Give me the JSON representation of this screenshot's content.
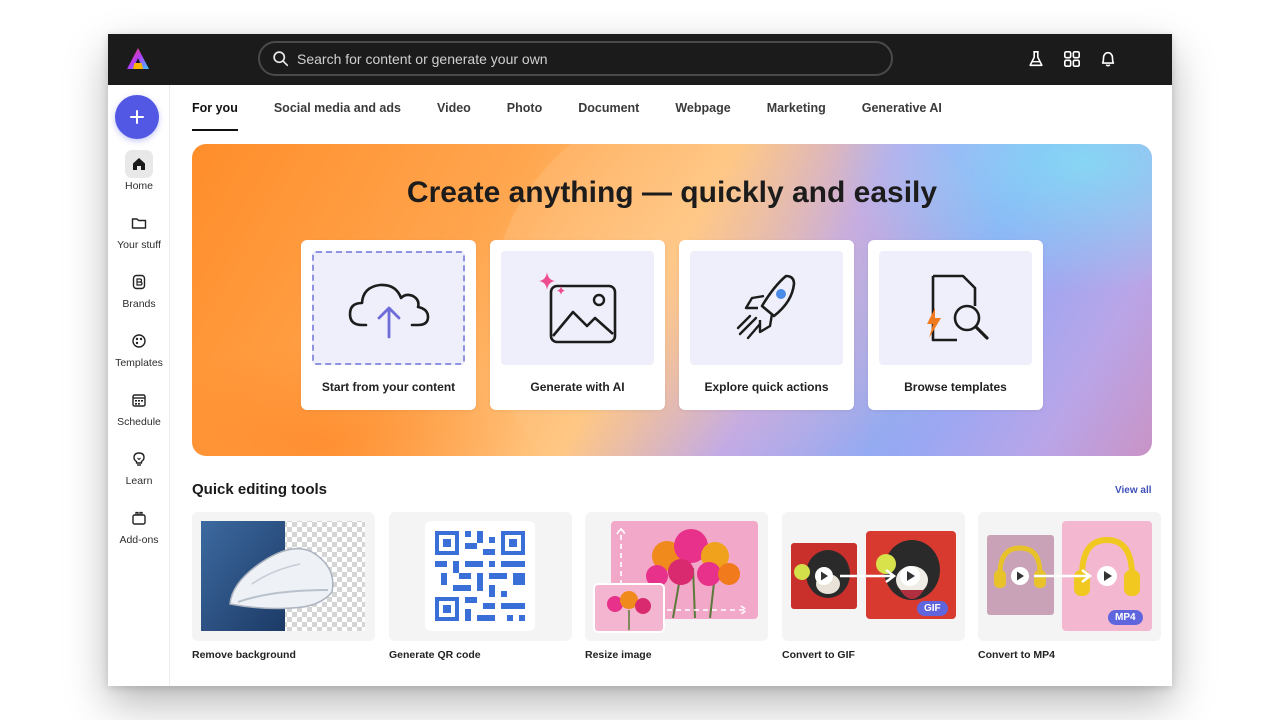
{
  "app": {
    "search_placeholder": "Search for content or generate your own",
    "brand_colors": [
      "#ff0000",
      "#7b3cff",
      "#ffb400",
      "#00b8e6"
    ],
    "accent": "#5258e4"
  },
  "topbar_icons": [
    {
      "name": "flask-icon"
    },
    {
      "name": "apps-grid-icon"
    },
    {
      "name": "bell-icon"
    }
  ],
  "sidebar": {
    "create_icon": "plus-icon",
    "items": [
      {
        "label": "Home",
        "icon": "home-icon",
        "active": true
      },
      {
        "label": "Your stuff",
        "icon": "folder-icon"
      },
      {
        "label": "Brands",
        "icon": "brand-icon"
      },
      {
        "label": "Templates",
        "icon": "templates-icon"
      },
      {
        "label": "Schedule",
        "icon": "calendar-icon"
      },
      {
        "label": "Learn",
        "icon": "lightbulb-icon"
      },
      {
        "label": "Add-ons",
        "icon": "addons-icon"
      }
    ]
  },
  "tabs": [
    {
      "label": "For you",
      "active": true
    },
    {
      "label": "Social media and ads"
    },
    {
      "label": "Video"
    },
    {
      "label": "Photo"
    },
    {
      "label": "Document"
    },
    {
      "label": "Webpage"
    },
    {
      "label": "Marketing"
    },
    {
      "label": "Generative AI"
    }
  ],
  "hero": {
    "title": "Create anything — quickly and easily",
    "cards": [
      {
        "label": "Start from your content",
        "icon": "cloud-upload-icon"
      },
      {
        "label": "Generate with AI",
        "icon": "ai-image-icon"
      },
      {
        "label": "Explore quick actions",
        "icon": "rocket-icon"
      },
      {
        "label": "Browse templates",
        "icon": "template-search-icon"
      }
    ]
  },
  "quick_tools": {
    "title": "Quick editing tools",
    "view_all": "View all",
    "items": [
      {
        "label": "Remove background"
      },
      {
        "label": "Generate QR code"
      },
      {
        "label": "Resize image"
      },
      {
        "label": "Convert to GIF",
        "badge": "GIF"
      },
      {
        "label": "Convert to MP4",
        "badge": "MP4"
      }
    ]
  }
}
